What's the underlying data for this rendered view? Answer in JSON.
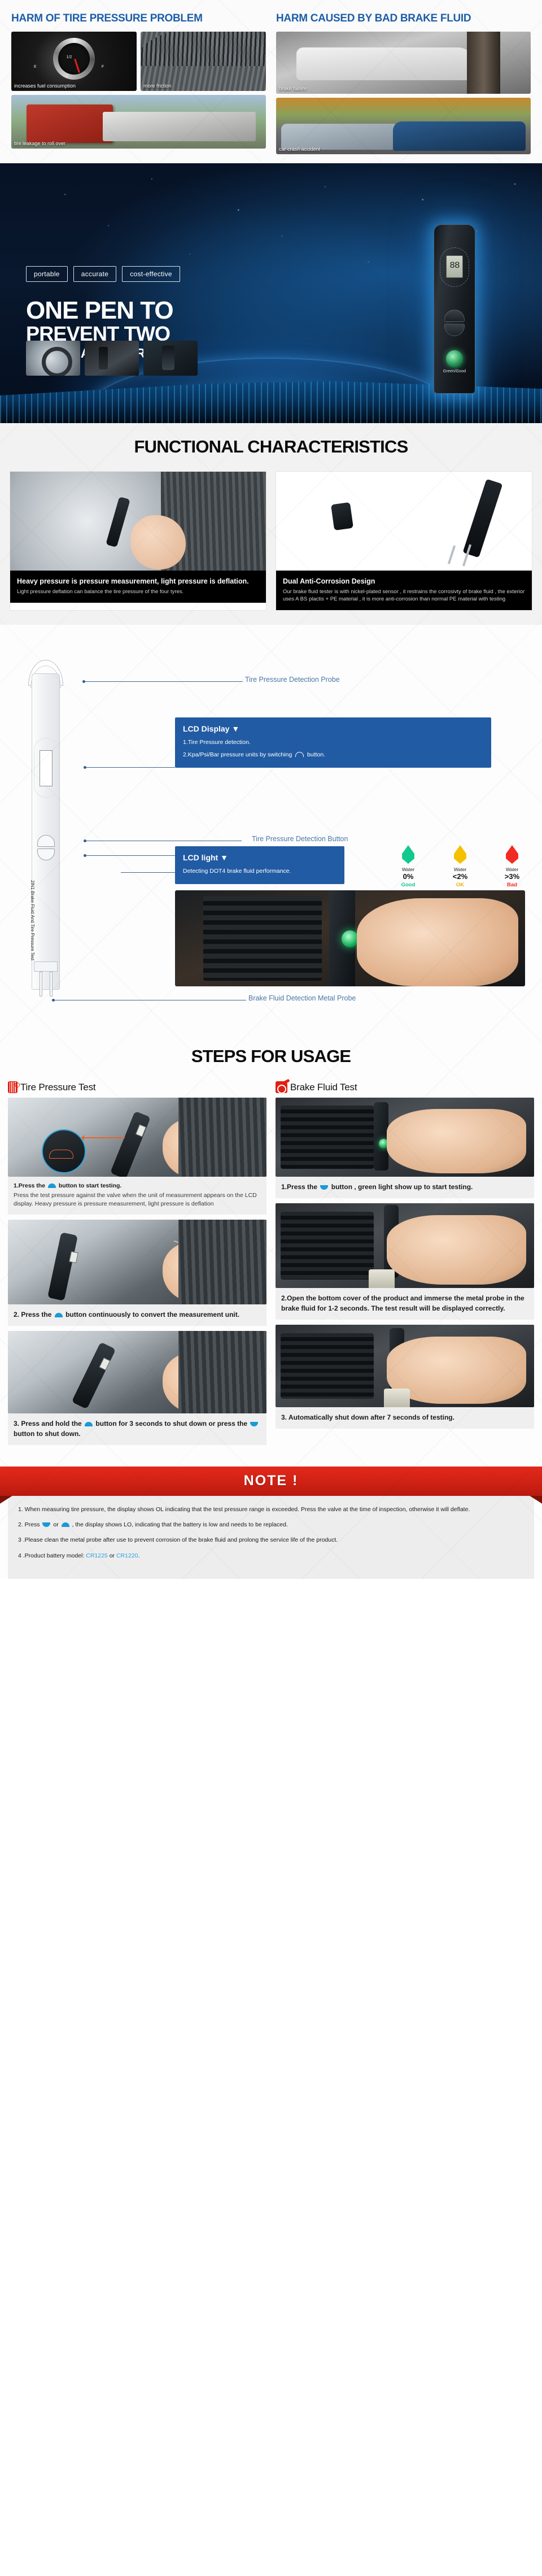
{
  "harm": {
    "left": {
      "title": "HARM OF TIRE PRESSURE PROBLEM",
      "photos": [
        {
          "caption": "increases fuel consumption",
          "name": "fuel-gauge-photo"
        },
        {
          "caption": "more friction",
          "name": "tire-tread-photo"
        },
        {
          "caption": "tire leakage to roll over",
          "name": "truck-rollover-photo"
        }
      ],
      "gauge_labels": {
        "empty": "E",
        "half": "1/2",
        "full": "F"
      }
    },
    "right": {
      "title": "HARM CAUSED BY BAD BRAKE FLUID",
      "photos": [
        {
          "caption": "brake failure",
          "name": "car-brake-failure-photo"
        },
        {
          "caption": "car crash accident",
          "name": "car-crash-photo"
        }
      ]
    }
  },
  "hero": {
    "tags": [
      "portable",
      "accurate",
      "cost-effective"
    ],
    "headline_line1": "ONE PEN TO",
    "headline_line2": "PREVENT TWO",
    "headline_line3": "POTENTIAL HAZARDS",
    "pen_lcd_value": "88",
    "pen_led_label": "Green/Good"
  },
  "functional": {
    "title": "FUNCTIONAL CHARACTERISTICS",
    "cards": [
      {
        "heading": "Heavy pressure is pressure measurement, light pressure is deflation.",
        "body": "Light pressure deflation can balance the tire pressure of the four tyres."
      },
      {
        "heading": "Dual Anti-Corrosion Design",
        "body": "Our brake fluid tester is with nickel-plated sensor , it restrains the corrosivty of brake fluid , the exterior uses A  BS plactis + PE material , it is more anti-corrosion than normal PE material with testing"
      }
    ]
  },
  "diagram": {
    "callouts": {
      "probe": "Tire Pressure Detection Probe",
      "tire_button": "Tire Pressure Detection Button",
      "brake_button": "Brake Fluid Detection Button",
      "metal_probe": "Brake Fluid Detection Metal Probe"
    },
    "lcd_display": {
      "title": "LCD Display",
      "line1": "1.Tire Pressure detection.",
      "line2_pre": "2.Kpa/Psi/Bar pressure units by switching",
      "line2_post": "button."
    },
    "lcd_light": {
      "title": "LCD light",
      "body": "Detecting DOT4 brake fluid performance."
    },
    "device_side_label": "2IN1 Brake Fluid And Tire Pressure Test",
    "indicators": [
      {
        "label": "Water",
        "value": "0%",
        "status": "Good",
        "color": "#12c98f"
      },
      {
        "label": "Water",
        "value": "<2%",
        "status": "OK",
        "color": "#f5c000"
      },
      {
        "label": "Water",
        "value": ">3%",
        "status": "Bad",
        "color": "#f02c22"
      }
    ]
  },
  "steps": {
    "title": "STEPS FOR USAGE",
    "tire": {
      "heading": "Tire Pressure Test",
      "items": [
        {
          "bold_pre": "1",
          "bold_main": ".Press the",
          "bold_post": "button to start testing.",
          "sub": "Press the test pressure against the valve when the unit of measurement appears on the LCD display. Heavy pressure is pressure measurement, light pressure is deflation"
        },
        {
          "bold_pre": "2.",
          "bold_main": "Press the",
          "bold_post": "button continuously to convert the measurement unit.",
          "callout": "Kpa/Psi/Ba"
        },
        {
          "bold_pre": "3.",
          "bold_main": "Press and hold the",
          "bold_post": "button for 3 seconds to shut down or press the",
          "bold_end": "button to shut down."
        }
      ]
    },
    "brake": {
      "heading": "Brake Fluid Test",
      "items": [
        {
          "bold_pre": "1.",
          "bold_main": "Press the",
          "bold_post": "button , green light show up to start testing."
        },
        {
          "bold_pre": "2.",
          "bold_main": "Open the bottom cover of the product and immerse the metal probe in the brake fluid for 1-2 seconds. The test result will be displayed correctly."
        },
        {
          "bold_pre": "3.",
          "bold_main": "Automatically shut down after 7 seconds of testing."
        }
      ]
    }
  },
  "note": {
    "title": "NOTE !",
    "items": [
      "1.  When measuring tire pressure, the display shows OL indicating that the test pressure range is exceeded. Press the valve at the time of inspection, otherwise it will deflate.",
      "2. Press",
      "3 .Please clean the metal probe after use to prevent corrosion of the brake fluid and prolong the service life of the product."
    ],
    "item2_mid": "or",
    "item2_tail": ", the display shows LO, indicating that the battery is low and needs to be replaced.",
    "item4_pre": "4 .Product battery model:",
    "battery1": "CR1225",
    "item4_mid": "or",
    "battery2": "CR1220",
    "item4_end": "."
  }
}
